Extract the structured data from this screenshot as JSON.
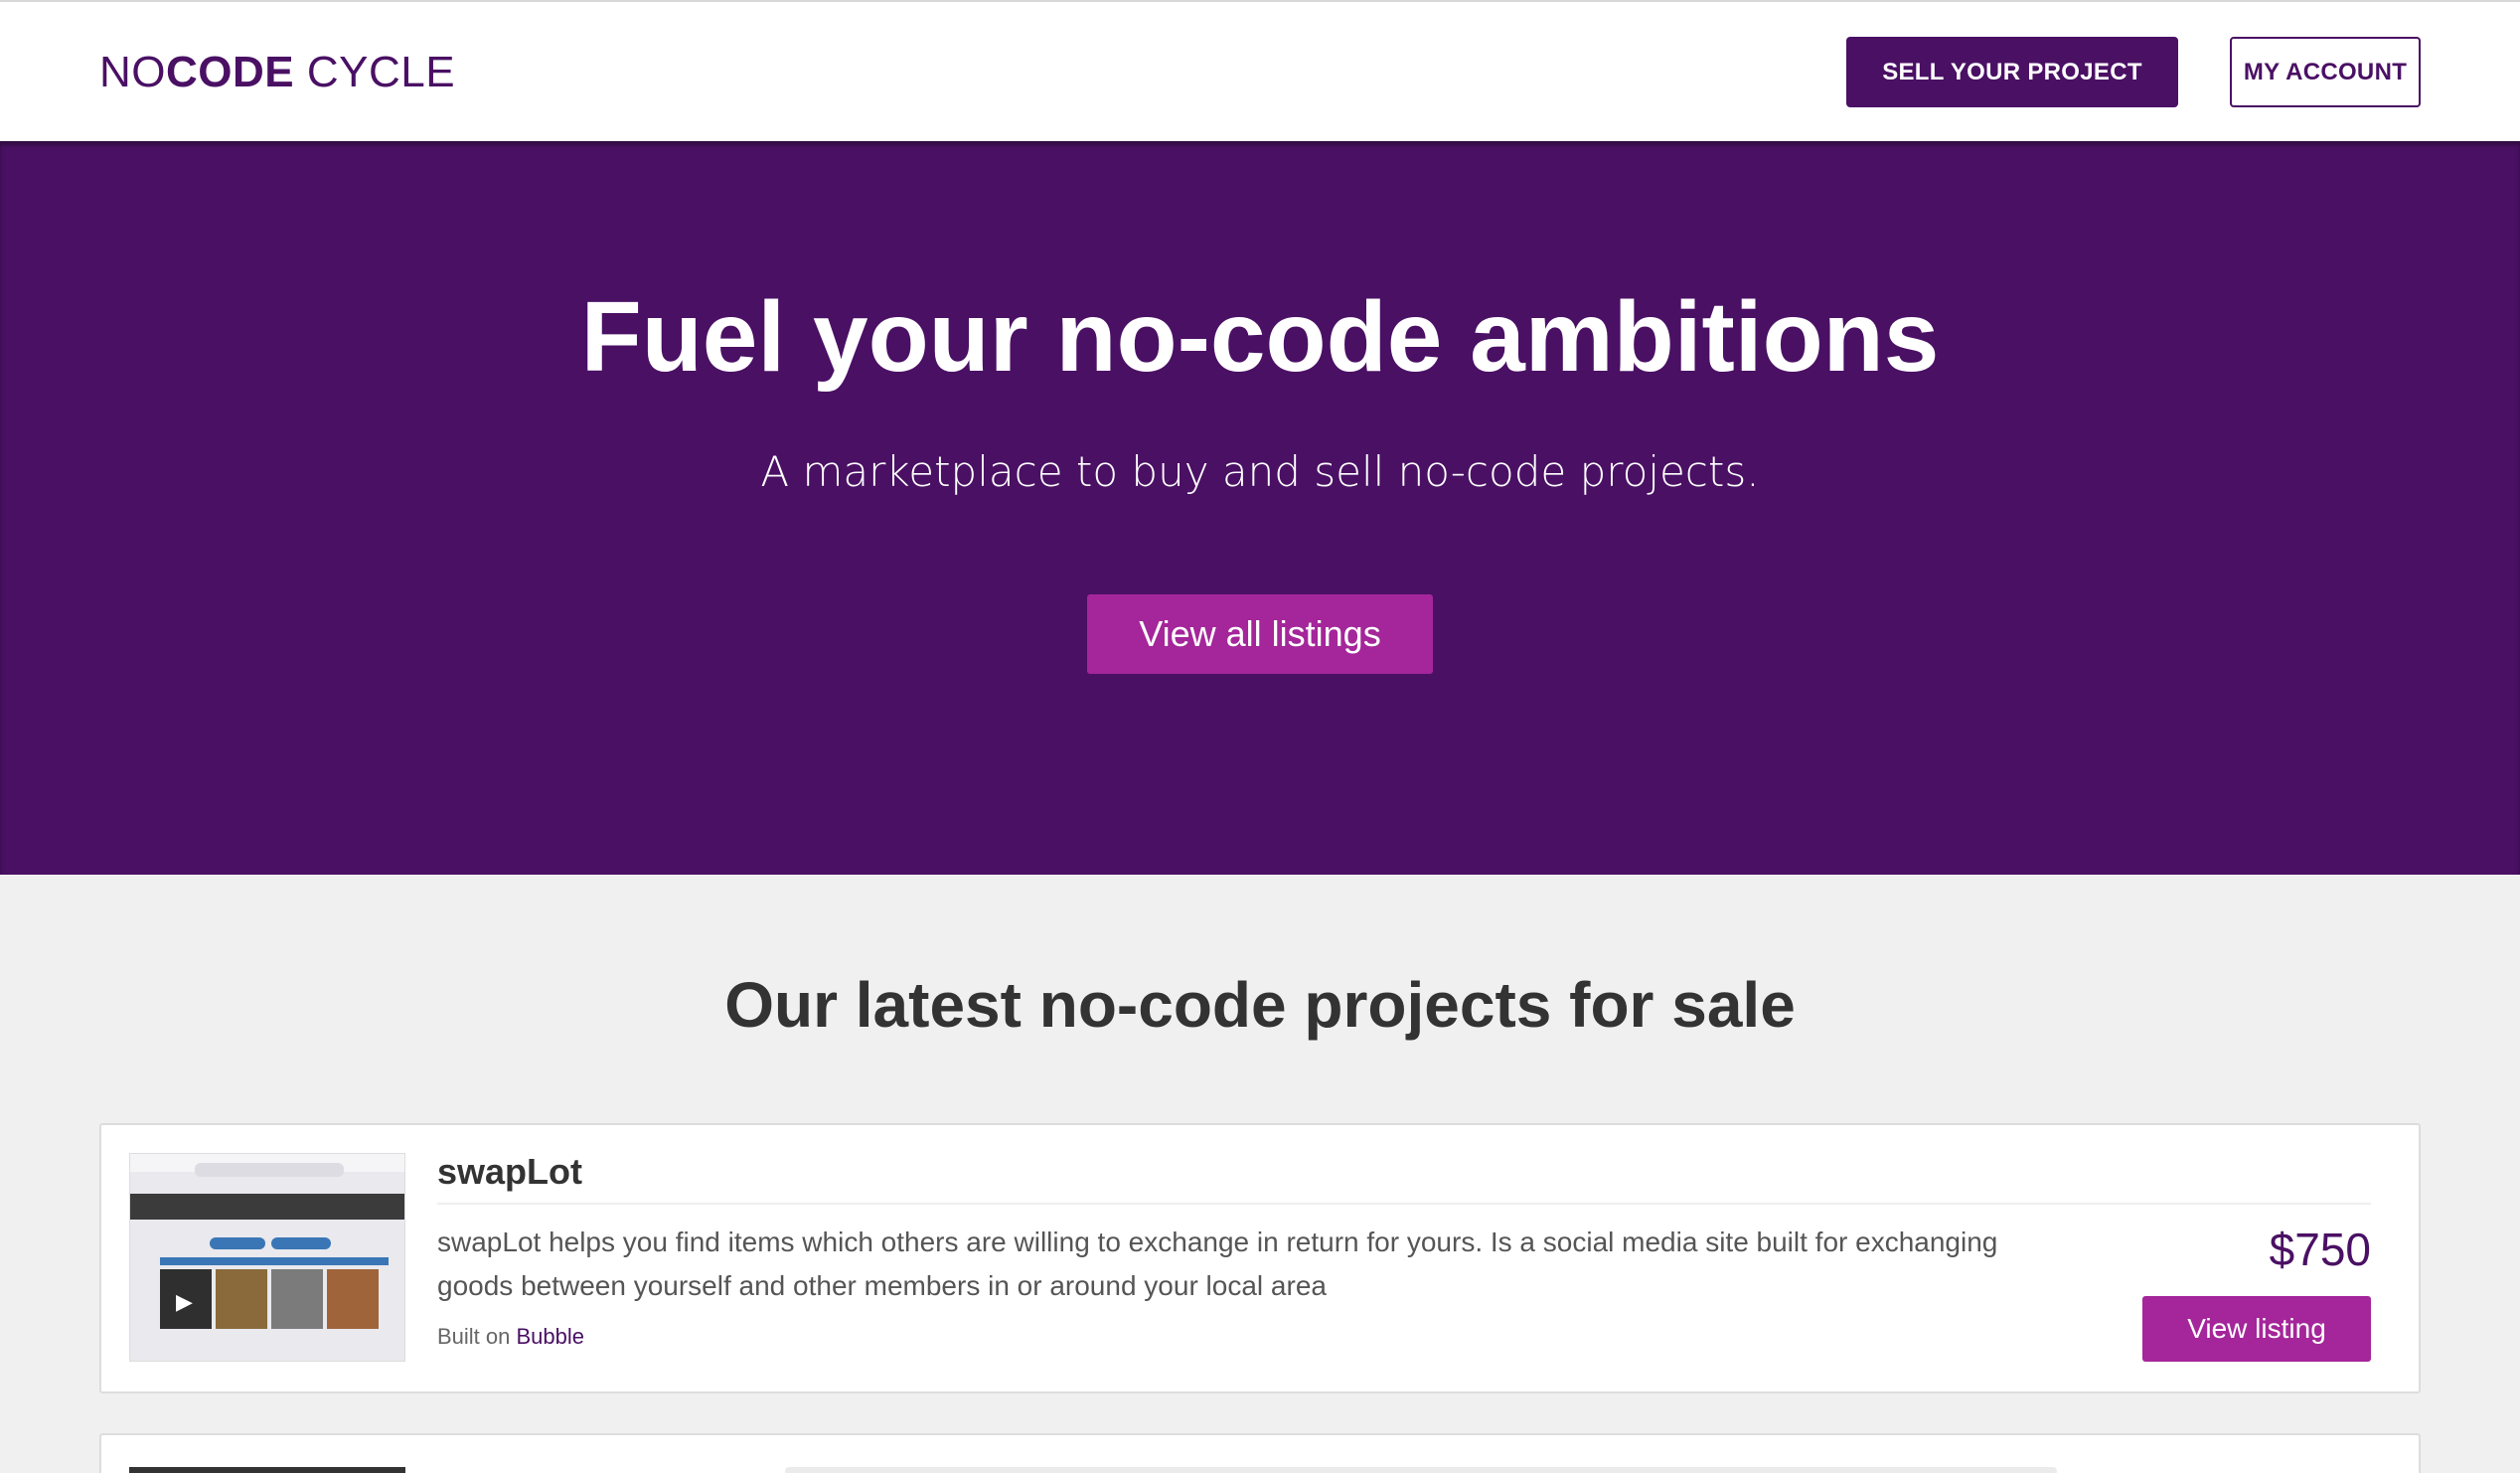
{
  "header": {
    "logo": {
      "prefix": "NO",
      "bold": "CODE",
      "suffix": " CYCLE"
    },
    "sell_label": "SELL YOUR PROJECT",
    "account_label": "MY ACCOUNT"
  },
  "hero": {
    "title": "Fuel your no-code ambitions",
    "subtitle": "A marketplace to buy and sell no-code projects.",
    "cta_label": "View all listings"
  },
  "listings_section": {
    "title": "Our latest no-code projects for sale",
    "listings": [
      {
        "name": "swapLot",
        "description": "swapLot helps you find items which others are willing to exchange in return for yours. Is a social media site built for exchanging goods between yourself and other members in or around your local area",
        "built_on_prefix": "Built on ",
        "platform": "Bubble",
        "price": "$750",
        "view_label": "View listing"
      }
    ]
  },
  "colors": {
    "brand": "#4a1064",
    "accent": "#a4269a",
    "background": "#f0f0f0"
  }
}
